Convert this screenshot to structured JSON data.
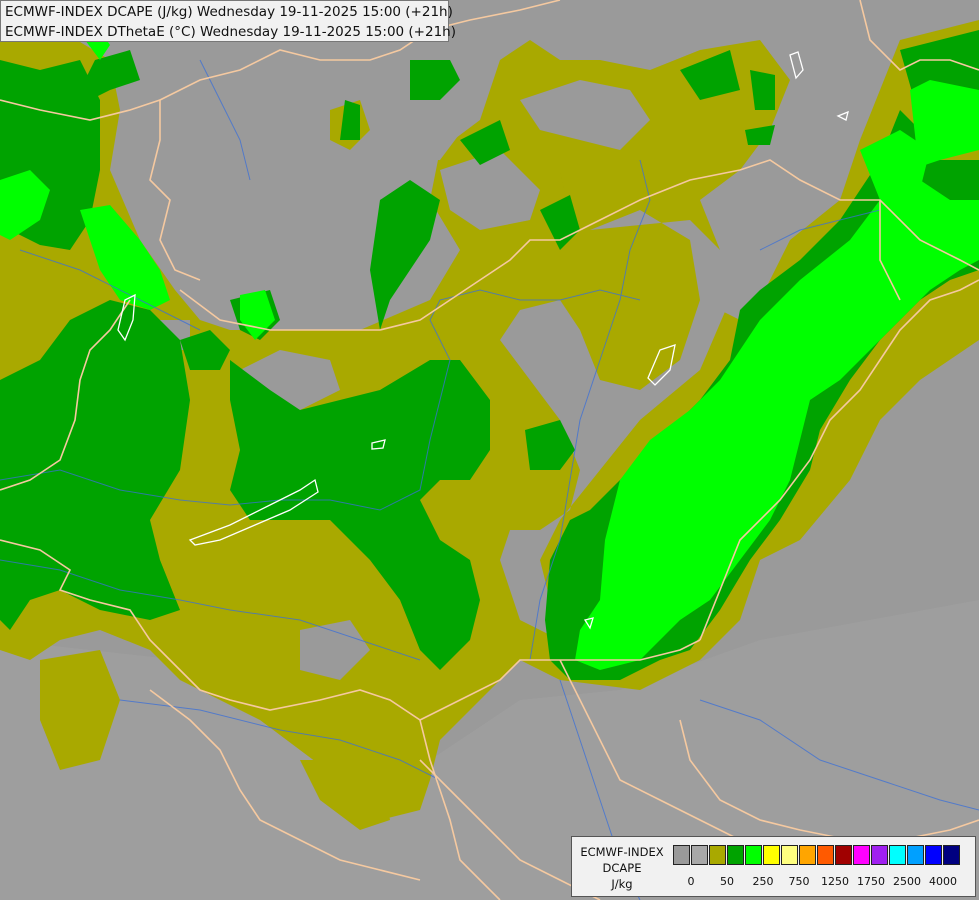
{
  "header": {
    "line1": "ECMWF-INDEX DCAPE (J/kg) Wednesday 19-11-2025 15:00 (+21h)",
    "line2": "ECMWF-INDEX DThetaE (°C) Wednesday 19-11-2025 15:00 (+21h)"
  },
  "legend": {
    "title_line1": "ECMWF-INDEX",
    "title_line2": "DCAPE",
    "title_line3": "J/kg",
    "colors": [
      "#9a9a9a",
      "#a8a8a8",
      "#a9a900",
      "#00a300",
      "#00ff00",
      "#ffff00",
      "#ffff80",
      "#ffa500",
      "#ff5a00",
      "#a00000",
      "#ff00ff",
      "#a020f0",
      "#00ffff",
      "#00a0ff",
      "#0000ff",
      "#000080"
    ],
    "ticks": [
      "0",
      "50",
      "250",
      "750",
      "1250",
      "1750",
      "2500",
      "4000"
    ]
  },
  "map_colors": {
    "background": "#9a9a9a",
    "olive": "#a9a900",
    "green": "#00a300",
    "lime": "#00ff00",
    "border": "#f5c9a0",
    "river": "#3060c0",
    "lake": "#ffffff"
  }
}
